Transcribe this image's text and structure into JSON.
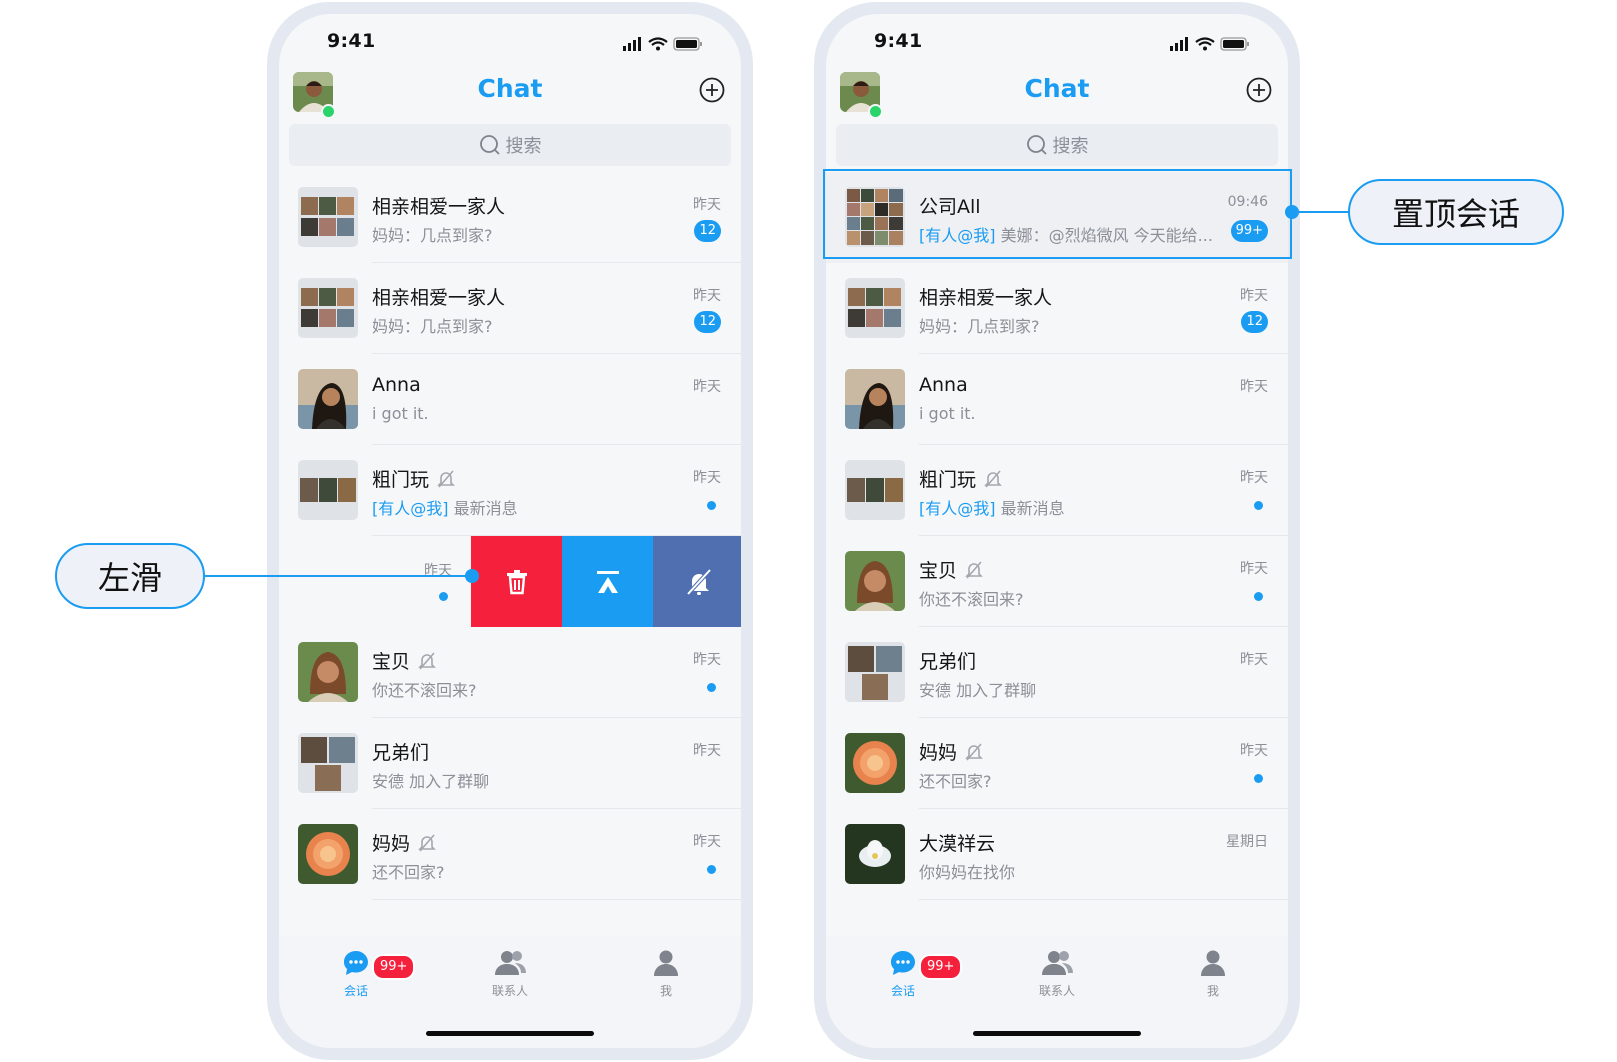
{
  "left_phone": {
    "status_time": "9:41",
    "title": "Chat",
    "search_placeholder": "搜索",
    "rows": [
      {
        "name": "相亲相爱一家人",
        "msg": "妈妈：几点到家?",
        "time": "昨天",
        "badge": "12"
      },
      {
        "name": "相亲相爱一家人",
        "msg": "妈妈：几点到家?",
        "time": "昨天",
        "badge": "12"
      },
      {
        "name": "Anna",
        "msg": "i got it.",
        "time": "昨天"
      },
      {
        "name": "粗门玩",
        "at": "[有人@我]",
        "msg": "最新消息",
        "time": "昨天"
      }
    ],
    "swipe_row": {
      "time": "昨天"
    },
    "rows_after": [
      {
        "name": "宝贝",
        "msg": "你还不滚回来?",
        "time": "昨天"
      },
      {
        "name": "兄弟们",
        "msg": "安德 加入了群聊",
        "time": "昨天"
      },
      {
        "name": "妈妈",
        "msg": "还不回家?",
        "time": "昨天"
      }
    ],
    "tabs": [
      {
        "label": "会话"
      },
      {
        "label": "联系人"
      },
      {
        "label": "我"
      }
    ],
    "tab_badge": "99+"
  },
  "right_phone": {
    "status_time": "9:41",
    "title": "Chat",
    "search_placeholder": "搜索",
    "rows": [
      {
        "name": "公司All",
        "at": "[有人@我]",
        "msg": "美娜：@烈焰微风 今天能给...",
        "time": "09:46",
        "badge": "99+"
      },
      {
        "name": "相亲相爱一家人",
        "msg": "妈妈：几点到家?",
        "time": "昨天",
        "badge": "12"
      },
      {
        "name": "Anna",
        "msg": "i got it.",
        "time": "昨天"
      },
      {
        "name": "粗门玩",
        "at": "[有人@我]",
        "msg": "最新消息",
        "time": "昨天"
      },
      {
        "name": "宝贝",
        "msg": "你还不滚回来?",
        "time": "昨天"
      },
      {
        "name": "兄弟们",
        "msg": "安德 加入了群聊",
        "time": "昨天"
      },
      {
        "name": "妈妈",
        "msg": "还不回家?",
        "time": "昨天"
      },
      {
        "name": "大漠祥云",
        "msg": "你妈妈在找你",
        "time": "星期日"
      }
    ],
    "tabs": [
      {
        "label": "会话"
      },
      {
        "label": "联系人"
      },
      {
        "label": "我"
      }
    ],
    "tab_badge": "99+"
  },
  "callouts": {
    "swipe_label": "左滑",
    "pin_label": "置顶会话"
  },
  "colors": {
    "accent": "#1a9cf2",
    "delete": "#f5213c",
    "pin": "#1a9cf2",
    "mute": "#4f6fb0"
  }
}
